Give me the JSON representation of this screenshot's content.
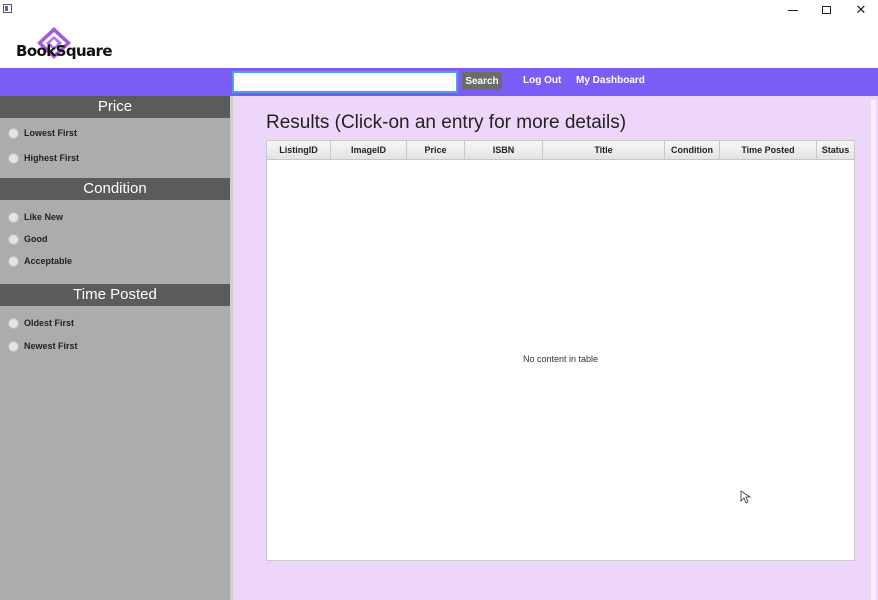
{
  "brand": {
    "logo_text": "BookSquare",
    "accent": "#7b5cf5"
  },
  "nav": {
    "search_placeholder": "",
    "search_value": "",
    "search_label": "Search",
    "logout_label": "Log Out",
    "dashboard_label": "My Dashboard"
  },
  "sidebar": {
    "sections": [
      {
        "title": "Price",
        "options": [
          "Lowest First",
          "Highest First"
        ]
      },
      {
        "title": "Condition",
        "options": [
          "Like New",
          "Good",
          "Acceptable"
        ]
      },
      {
        "title": "Time Posted",
        "options": [
          "Oldest First",
          "Newest First"
        ]
      }
    ]
  },
  "results": {
    "title": "Results (Click-on an entry for more details)",
    "columns": [
      "ListingID",
      "ImageID",
      "Price",
      "ISBN",
      "Title",
      "Condition",
      "Time Posted",
      "Status"
    ],
    "rows": [],
    "empty_message": "No content in table"
  },
  "icons": {
    "window_min": "minimize-icon",
    "window_max": "maximize-icon",
    "window_close": "close-icon"
  }
}
